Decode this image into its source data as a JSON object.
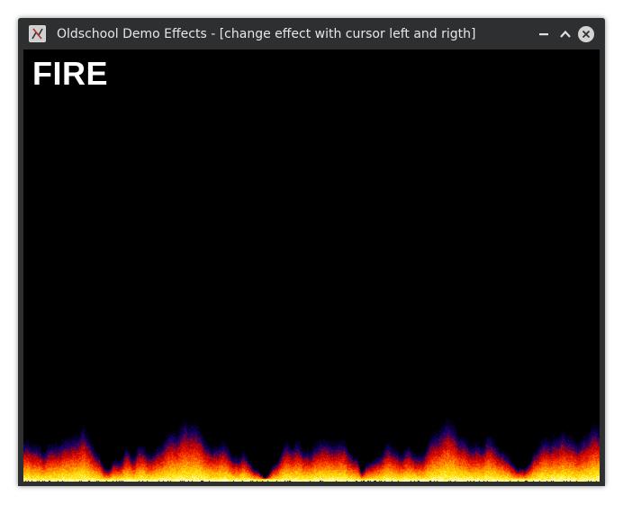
{
  "window": {
    "title": "Oldschool Demo Effects - [change effect with cursor left and rigth]",
    "icon": "app-icon",
    "controls": {
      "minimize": "minimize-icon",
      "maximize": "maximize-icon",
      "close": "close-icon"
    }
  },
  "canvas": {
    "effect_name": "FIRE",
    "background": "#000000",
    "fire_colors": [
      "#000010",
      "#10007a",
      "#c80000",
      "#ff4000",
      "#ff9a00",
      "#ffe800",
      "#fffbd0"
    ]
  }
}
